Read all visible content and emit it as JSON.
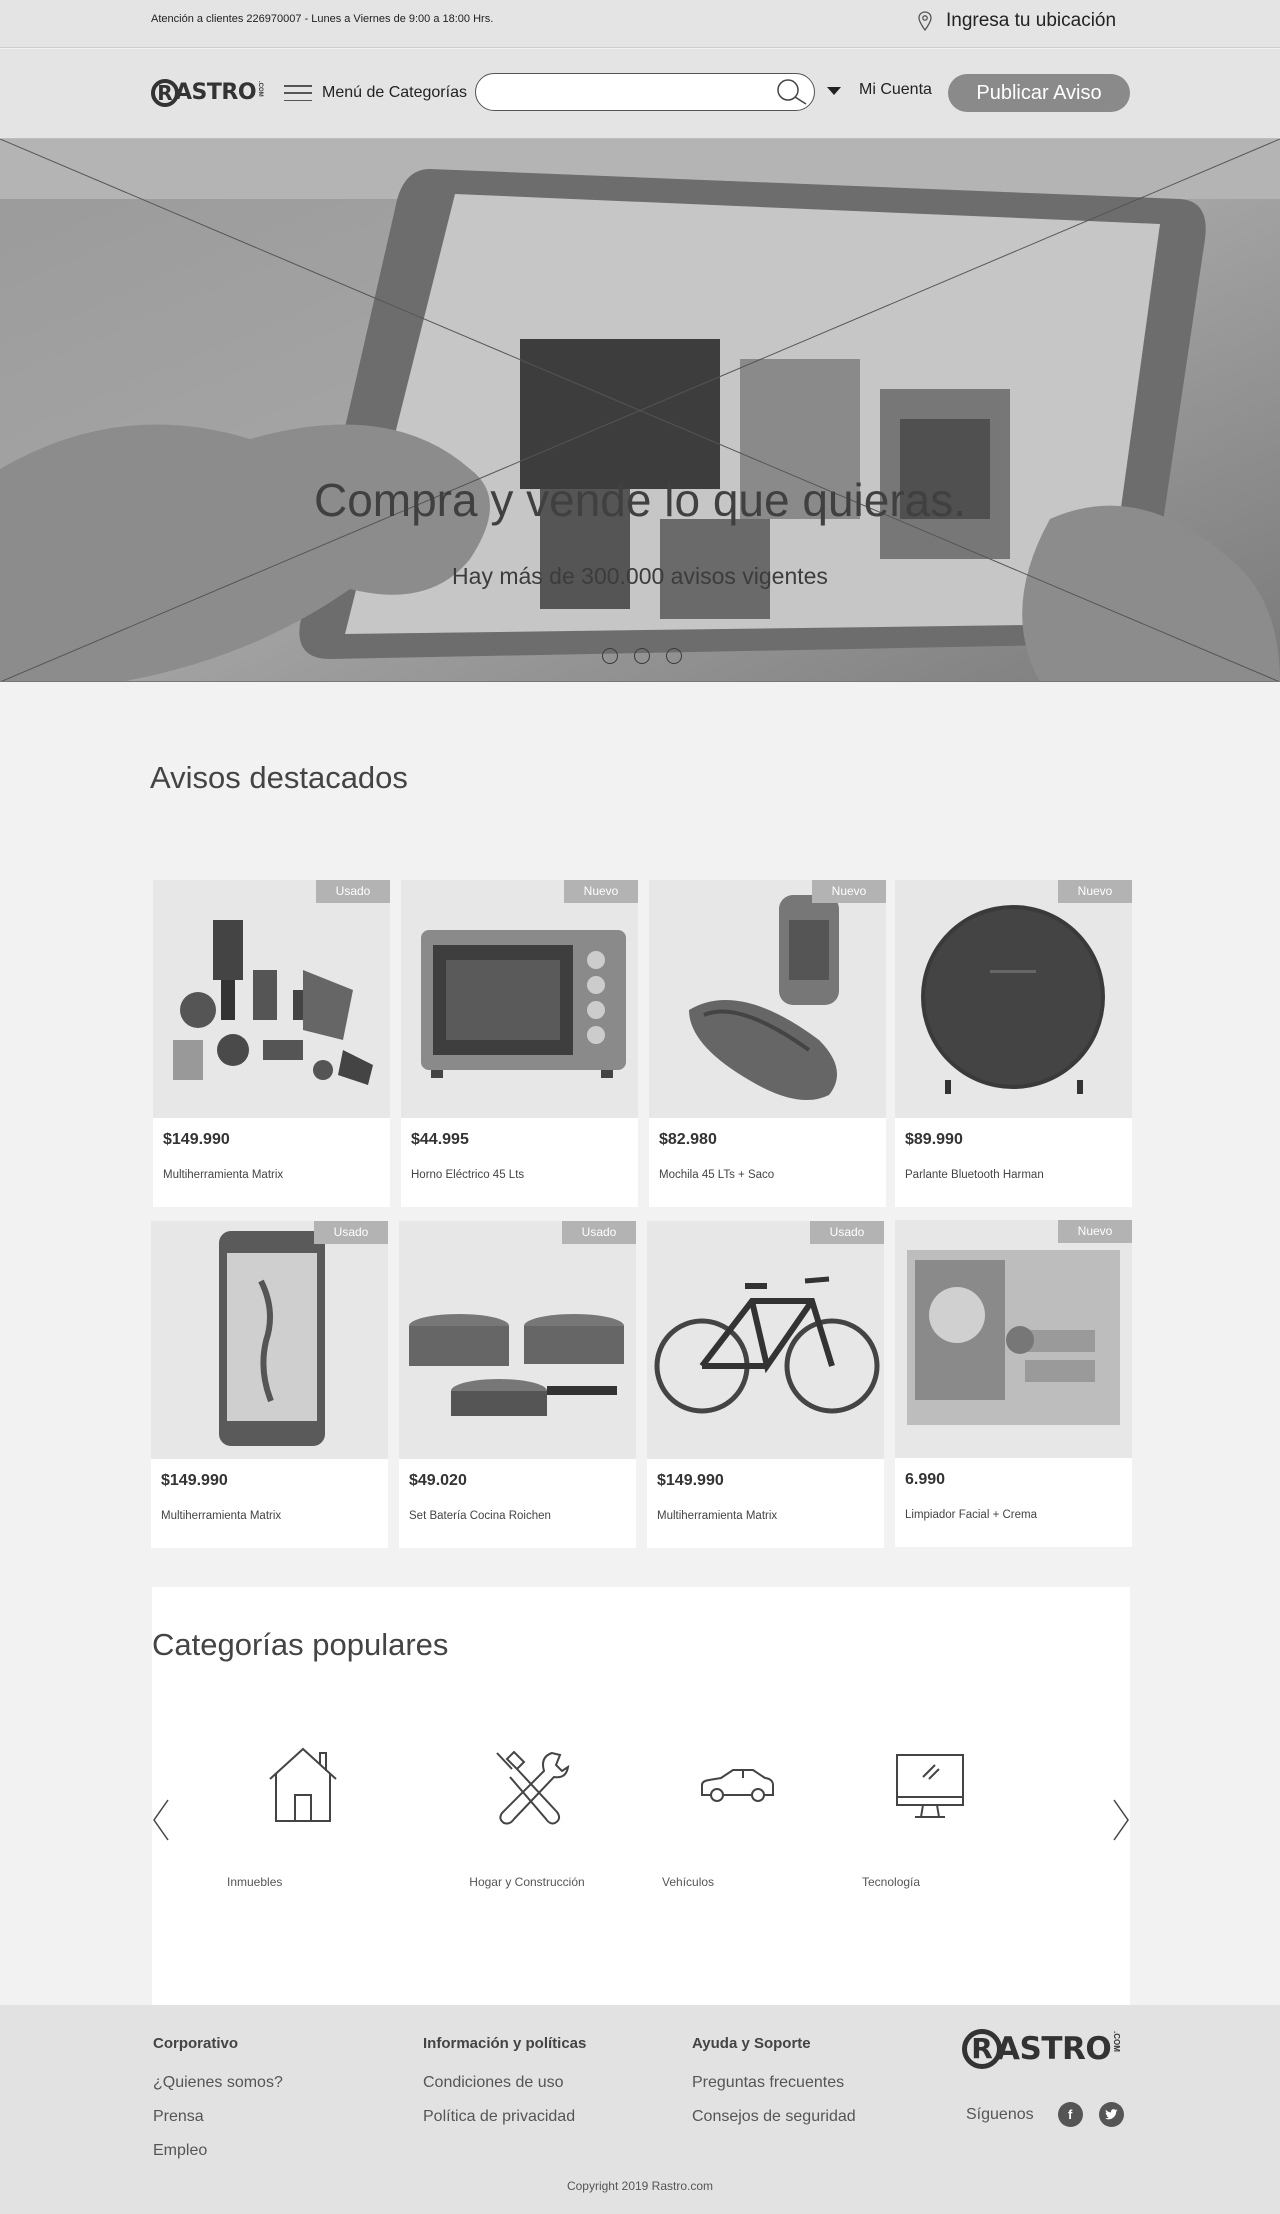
{
  "topbar": {
    "support_text": "Atención a clientes 226970007 - Lunes a Viernes de 9:00 a 18:00 Hrs.",
    "location_label": "Ingresa tu ubicación",
    "location_icon": "location-pin-icon"
  },
  "header": {
    "logo_r": "R",
    "logo_rest": "ASTRO",
    "logo_com": ".COM",
    "menu_label": "Menú de Categorías",
    "search_value": "",
    "search_placeholder": "",
    "account_label": "Mi Cuenta",
    "publish_label": "Publicar Aviso"
  },
  "hero": {
    "title": "Compra y vende lo que quieras.",
    "subtitle": "Hay más de 300.000 avisos vigentes",
    "slide_count": 3
  },
  "featured": {
    "title": "Avisos destacados",
    "items": [
      {
        "badge": "Usado",
        "price": "$149.990",
        "name": "Multiherramienta Matrix",
        "icon": "power-tools-icon"
      },
      {
        "badge": "Nuevo",
        "price": "$44.995",
        "name": "Horno Eléctrico 45 Lts",
        "icon": "oven-icon"
      },
      {
        "badge": "Nuevo",
        "price": "$82.980",
        "name": "Mochila 45 LTs + Saco",
        "icon": "backpack-icon"
      },
      {
        "badge": "Nuevo",
        "price": "$89.990",
        "name": "Parlante Bluetooth Harman",
        "icon": "speaker-icon"
      },
      {
        "badge": "Usado",
        "price": "$149.990",
        "name": "Multiherramienta Matrix",
        "icon": "smartphone-icon"
      },
      {
        "badge": "Usado",
        "price": "$49.020",
        "name": "Set Batería Cocina Roichen",
        "icon": "cookware-icon"
      },
      {
        "badge": "Usado",
        "price": "$149.990",
        "name": "Multiherramienta Matrix",
        "icon": "bicycle-icon"
      },
      {
        "badge": "Nuevo",
        "price": "6.990",
        "name": "Limpiador Facial + Crema",
        "icon": "facial-kit-icon"
      }
    ]
  },
  "categories": {
    "title": "Categorías populares",
    "items": [
      {
        "label": "Inmuebles",
        "icon": "house-icon"
      },
      {
        "label": "Hogar y Construcción",
        "icon": "tools-icon"
      },
      {
        "label": "Vehículos",
        "icon": "car-icon"
      },
      {
        "label": "Tecnología",
        "icon": "monitor-icon"
      }
    ]
  },
  "footer": {
    "col1": {
      "title": "Corporativo",
      "links": [
        "¿Quienes somos?",
        "Prensa",
        "Empleo"
      ]
    },
    "col2": {
      "title": "Información y políticas",
      "links": [
        "Condiciones de uso",
        "Política de privacidad"
      ]
    },
    "col3": {
      "title": "Ayuda y Soporte",
      "links": [
        "Preguntas frecuentes",
        "Consejos de seguridad"
      ]
    },
    "follow_label": "Síguenos",
    "facebook": "f",
    "twitter": "t",
    "copyright": "Copyright 2019 Rastro.com"
  }
}
